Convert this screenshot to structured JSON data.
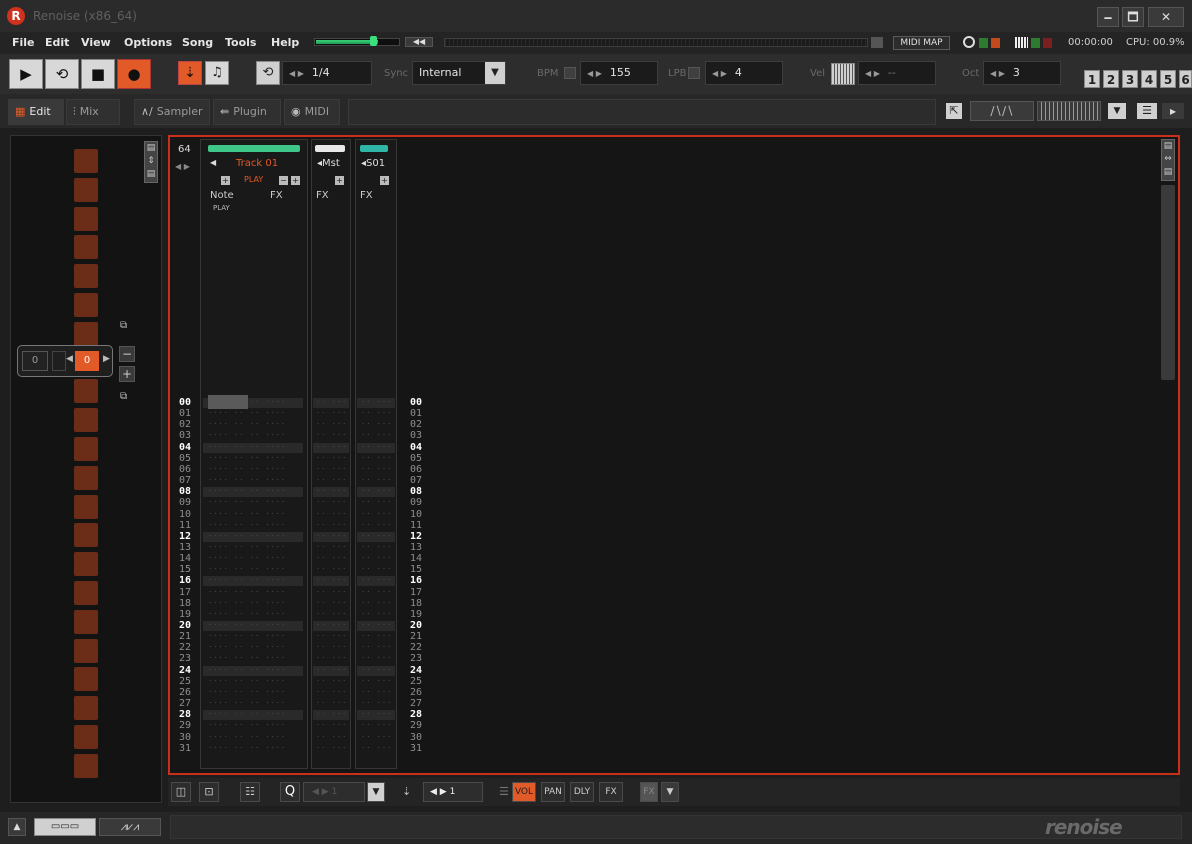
{
  "window": {
    "title": "Renoise (x86_64)",
    "app_icon": "renoise-logo-icon",
    "min_label": "🗕",
    "max_label": "🗖",
    "close_label": "✕"
  },
  "menu": [
    "File",
    "Edit",
    "View",
    "Options",
    "Song",
    "Tools",
    "Help"
  ],
  "master": {
    "volume_fraction": 0.74,
    "mute_label": "◀◀"
  },
  "midi_map_label": "MIDI MAP",
  "status": {
    "time": "00:00:00",
    "cpu": "CPU: 00.9%"
  },
  "transport": {
    "play": "▶",
    "loop": "⟲",
    "stop": "■",
    "record": "●",
    "metronome": "♫",
    "pattern_loop": "⟲",
    "block_size": "1/4",
    "sync_label": "Sync",
    "sync_value": "Internal",
    "bpm_label": "BPM",
    "bpm_value": "155",
    "lpb_label": "LPB",
    "lpb_value": "4",
    "vel_label": "Vel",
    "vel_value": "--",
    "oct_label": "Oct",
    "oct_value": "3",
    "arrows": "◀ ▶",
    "dropdown_arrow": "▼"
  },
  "page_buttons": [
    "1",
    "2",
    "3",
    "4",
    "5",
    "6"
  ],
  "tabs": {
    "edit": "Edit",
    "mix": "Mix",
    "sampler": "Sampler",
    "plugin": "Plugin",
    "midi": "MIDI"
  },
  "sequencer": {
    "left_value": "0",
    "current_value": "0",
    "minus": "−",
    "plus": "+"
  },
  "pattern": {
    "lines": "64",
    "track1_name": "Track 01",
    "track1_state": "PLAY",
    "note_label": "Note",
    "fx_label": "FX",
    "play_label": "PLAY",
    "master_name": "Mst",
    "send_name": "S01"
  },
  "row_numbers": [
    "00",
    "01",
    "02",
    "03",
    "04",
    "05",
    "06",
    "07",
    "08",
    "09",
    "10",
    "11",
    "12",
    "13",
    "14",
    "15",
    "16",
    "17",
    "18",
    "19",
    "20",
    "21",
    "22",
    "23",
    "24",
    "25",
    "26",
    "27",
    "28",
    "29",
    "30",
    "31"
  ],
  "bottom": {
    "q_label": "Q",
    "q_value": "1",
    "step_value": "1",
    "vol": "VOL",
    "pan": "PAN",
    "dly": "DLY",
    "fx": "FX",
    "fx2": "FX"
  },
  "brand": "renoise",
  "colors": {
    "accent": "#e25a27",
    "record": "#e05a2a",
    "pattern_border": "#c8301c",
    "track1": "#3fc78a",
    "master": "#e8e8e8",
    "send": "#2fb6a6"
  }
}
